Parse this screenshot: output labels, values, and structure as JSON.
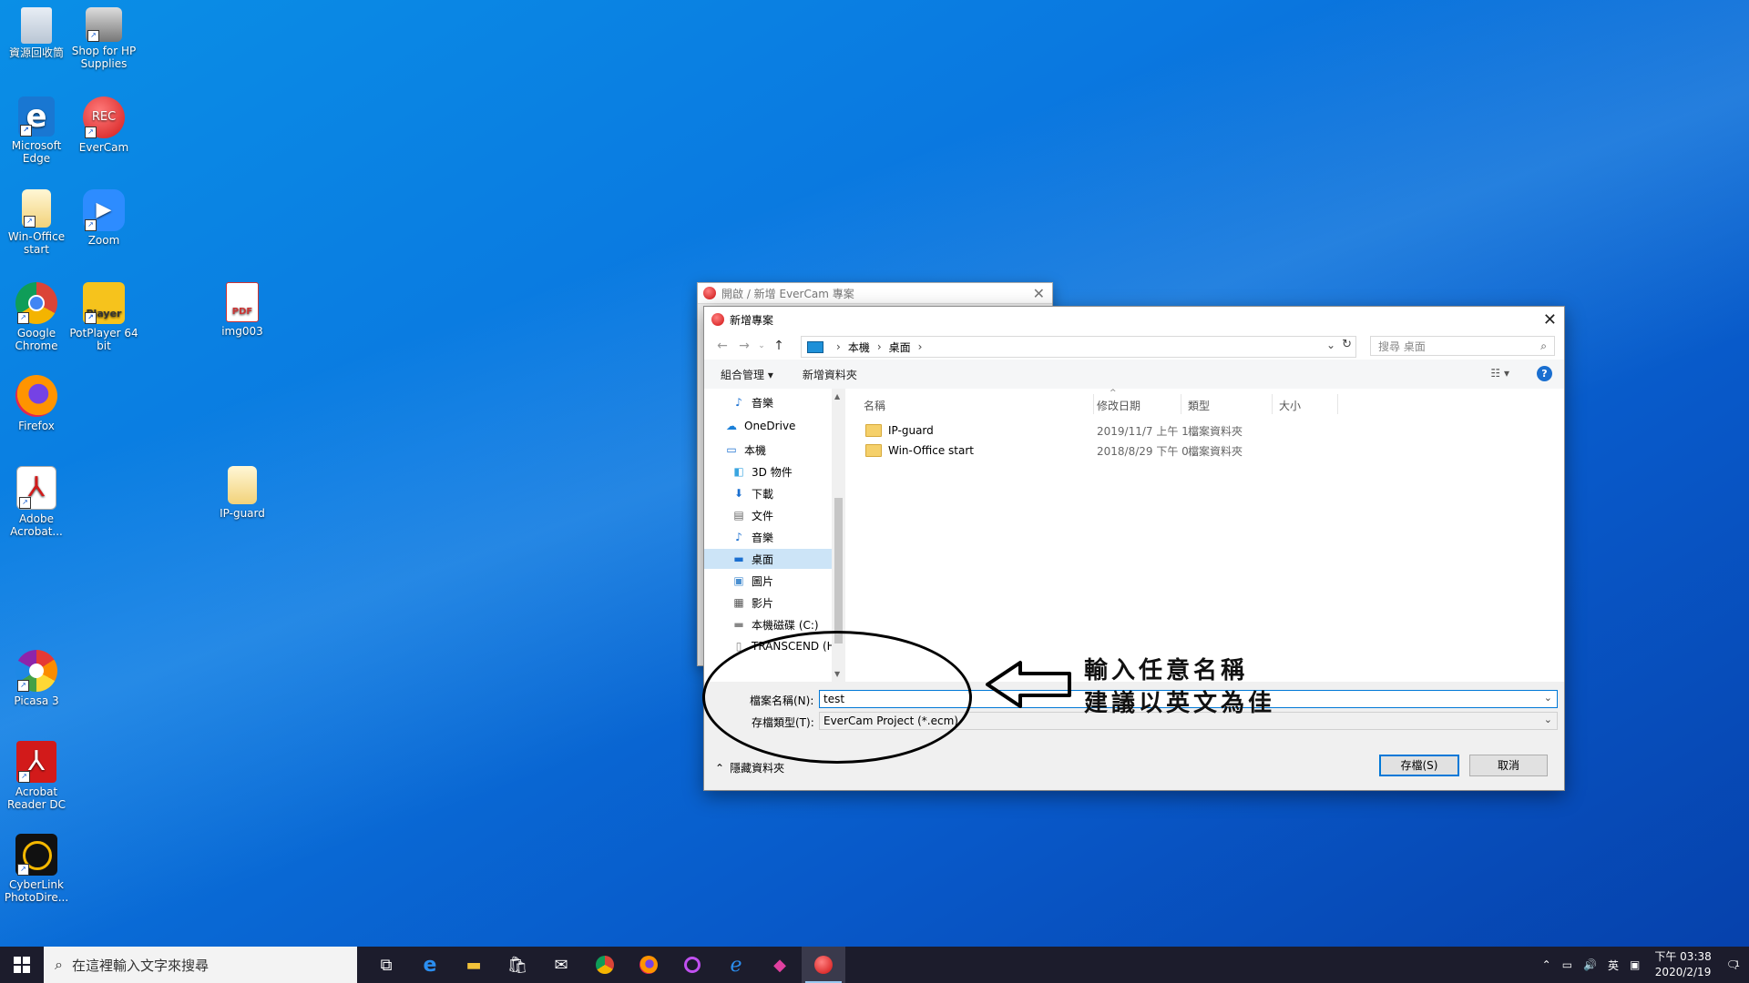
{
  "desktop": {
    "icons": [
      {
        "label": "資源回收筒"
      },
      {
        "label": "Shop for HP Supplies"
      },
      {
        "label": "Microsoft Edge"
      },
      {
        "label": "EverCam",
        "badge": "REC"
      },
      {
        "label": "Win-Office start"
      },
      {
        "label": "Zoom"
      },
      {
        "label": "Google Chrome"
      },
      {
        "label": "PotPlayer 64 bit",
        "badge": "Player"
      },
      {
        "label": "img003",
        "badge": "PDF"
      },
      {
        "label": "Firefox"
      },
      {
        "label": "Adobe Acrobat..."
      },
      {
        "label": "IP-guard"
      },
      {
        "label": "Picasa 3"
      },
      {
        "label": "Acrobat Reader DC"
      },
      {
        "label": "CyberLink PhotoDire..."
      }
    ]
  },
  "back_dialog": {
    "title": "開啟 / 新增 EverCam 專案"
  },
  "dialog": {
    "title": "新增專案",
    "address": {
      "parts": [
        "本機",
        "桌面"
      ]
    },
    "search_placeholder": "搜尋 桌面",
    "toolbar": {
      "organize": "組合管理 ▾",
      "new_folder": "新增資料夾",
      "help": "?"
    },
    "nav": [
      {
        "label": "音樂"
      },
      {
        "label": "OneDrive"
      },
      {
        "label": "本機"
      },
      {
        "label": "3D 物件"
      },
      {
        "label": "下載"
      },
      {
        "label": "文件"
      },
      {
        "label": "音樂"
      },
      {
        "label": "桌面",
        "selected": true
      },
      {
        "label": "圖片"
      },
      {
        "label": "影片"
      },
      {
        "label": "本機磁碟 (C:)"
      },
      {
        "label": "TRANSCEND (H"
      }
    ],
    "columns": {
      "name": "名稱",
      "modified": "修改日期",
      "type": "類型",
      "size": "大小"
    },
    "files": [
      {
        "name": "IP-guard",
        "modified": "2019/11/7 上午 1...",
        "type": "檔案資料夾"
      },
      {
        "name": "Win-Office start",
        "modified": "2018/8/29 下午 0...",
        "type": "檔案資料夾"
      }
    ],
    "filename_label": "檔案名稱(N):",
    "filename_value": "test",
    "filetype_label": "存檔類型(T):",
    "filetype_value": "EverCam Project (*.ecm)",
    "hide_folders": "隱藏資料夾",
    "save_button": "存檔(S)",
    "cancel_button": "取消"
  },
  "annotation": {
    "line1": "輸入任意名稱",
    "line2": "建議以英文為佳"
  },
  "taskbar": {
    "search_placeholder": "在這裡輸入文字來搜尋",
    "ime": "英",
    "time": "下午 03:38",
    "date": "2020/2/19",
    "notifications": "1"
  }
}
